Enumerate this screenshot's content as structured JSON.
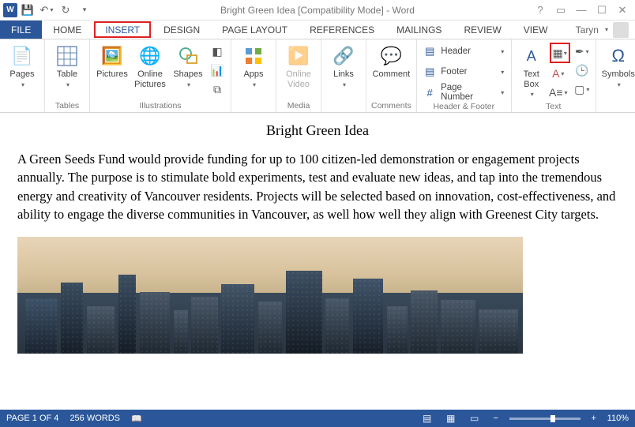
{
  "titlebar": {
    "title": "Bright Green Idea [Compatibility Mode] - Word"
  },
  "tabs": {
    "file": "FILE",
    "items": [
      "HOME",
      "INSERT",
      "DESIGN",
      "PAGE LAYOUT",
      "REFERENCES",
      "MAILINGS",
      "REVIEW",
      "VIEW"
    ],
    "active": "INSERT",
    "user": "Taryn"
  },
  "ribbon": {
    "pages": {
      "label": "Pages"
    },
    "tables": {
      "btn": "Table",
      "group": "Tables"
    },
    "illustrations": {
      "pictures": "Pictures",
      "online_pictures": "Online Pictures",
      "shapes": "Shapes",
      "group": "Illustrations"
    },
    "apps": {
      "btn": "Apps"
    },
    "media": {
      "btn": "Online Video",
      "group": "Media"
    },
    "links": {
      "btn": "Links"
    },
    "comments": {
      "btn": "Comment",
      "group": "Comments"
    },
    "header_footer": {
      "header": "Header",
      "footer": "Footer",
      "page_number": "Page Number",
      "group": "Header & Footer"
    },
    "text": {
      "textbox": "Text Box",
      "group": "Text"
    },
    "symbols": {
      "btn": "Symbols"
    }
  },
  "document": {
    "title": "Bright Green Idea",
    "body": "A Green Seeds Fund would provide funding for up to 100 citizen-led demonstration or engagement projects annually. The purpose is to stimulate bold experiments, test and evaluate new ideas, and tap into the tremendous energy and creativity of Vancouver residents. Projects will be selected based on innovation, cost-effectiveness, and ability to engage the diverse communities in Vancouver, as well how well they align with Greenest City targets."
  },
  "statusbar": {
    "page": "PAGE 1 OF 4",
    "words": "256 WORDS",
    "zoom": "110%"
  }
}
